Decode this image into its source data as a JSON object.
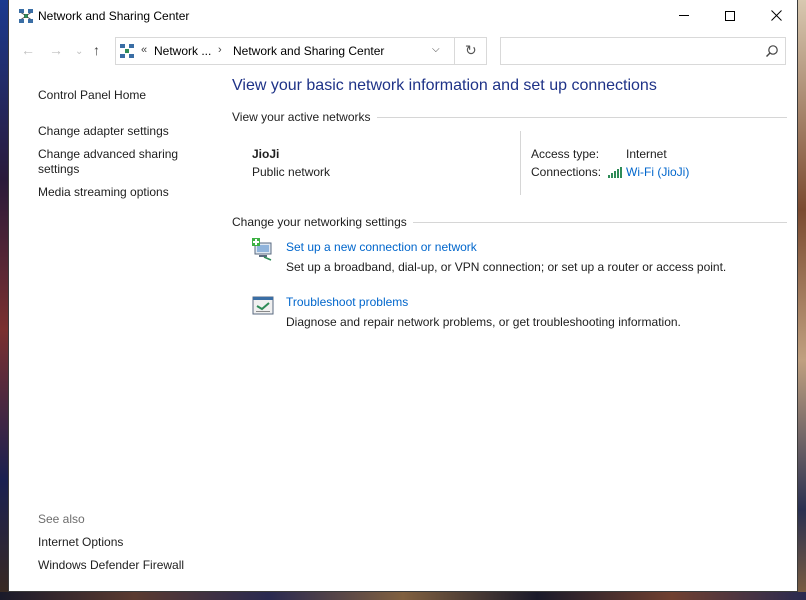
{
  "window": {
    "title": "Network and Sharing Center"
  },
  "address_bar": {
    "overflow_chevron": "«",
    "crumbs": [
      "Network ...",
      "Network and Sharing Center"
    ],
    "separator": "›"
  },
  "search": {
    "placeholder": ""
  },
  "left_pane": {
    "links": [
      "Control Panel Home",
      "Change adapter settings",
      "Change advanced sharing settings",
      "Media streaming options"
    ],
    "see_also_title": "See also",
    "see_also_links": [
      "Internet Options",
      "Windows Defender Firewall"
    ]
  },
  "main": {
    "heading": "View your basic network information and set up connections",
    "active_networks_title": "View your active networks",
    "network": {
      "name": "JioJi",
      "type": "Public network",
      "access_type_label": "Access type:",
      "access_type_value": "Internet",
      "connections_label": "Connections:",
      "connections_value": "Wi-Fi (JioJi)"
    },
    "change_settings_title": "Change your networking settings",
    "tasks": [
      {
        "link": "Set up a new connection or network",
        "description": "Set up a broadband, dial-up, or VPN connection; or set up a router or access point."
      },
      {
        "link": "Troubleshoot problems",
        "description": "Diagnose and repair network problems, or get troubleshooting information."
      }
    ]
  },
  "colors": {
    "heading": "#1e3287",
    "link": "#0066cc",
    "muted": "#6d6d6d"
  }
}
